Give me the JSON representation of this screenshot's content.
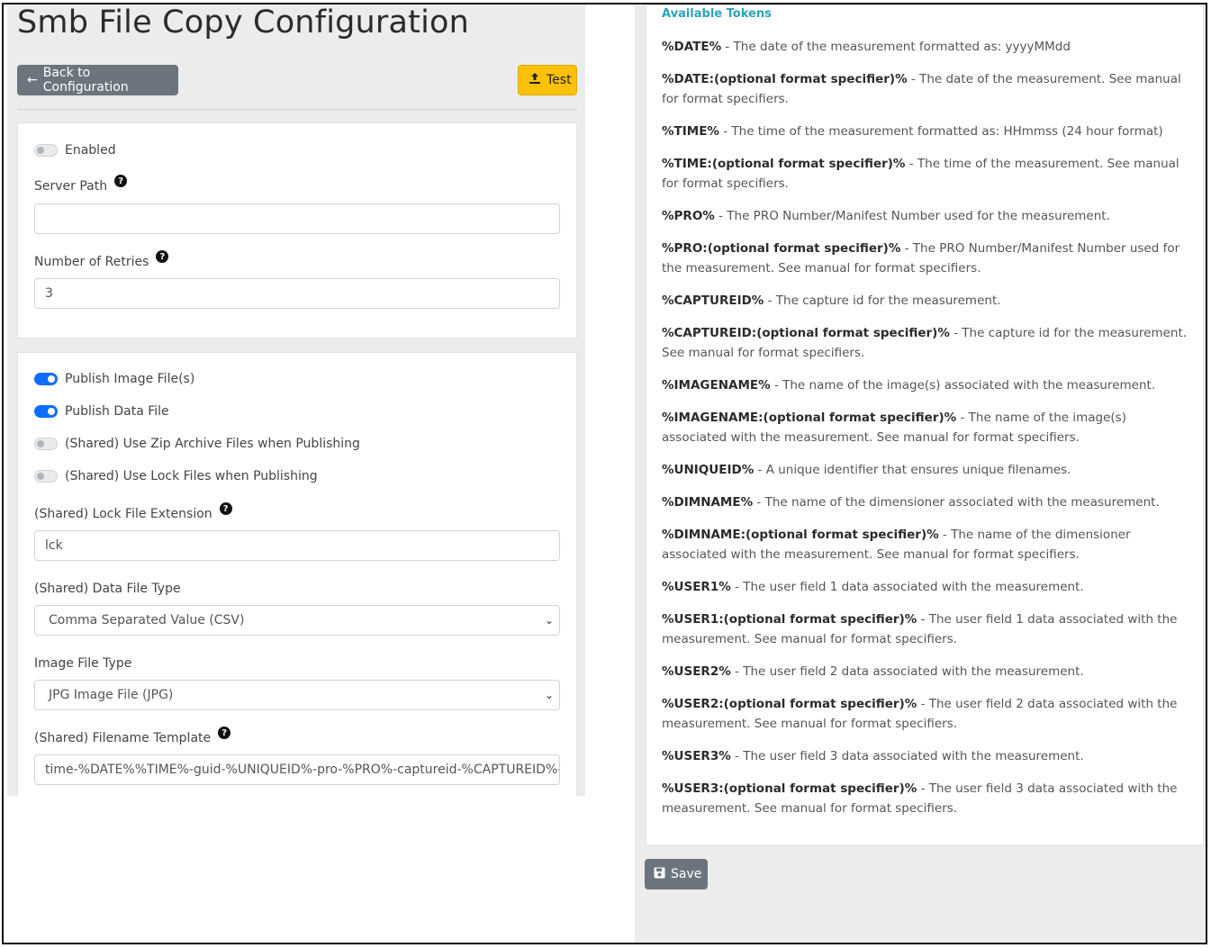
{
  "page": {
    "title": "Smb File Copy Configuration"
  },
  "toolbar": {
    "back_label": "Back to Configuration",
    "test_label": "Test",
    "save_label": "Save"
  },
  "general": {
    "enabled_label": "Enabled",
    "server_path_label": "Server Path",
    "server_path_value": "",
    "retries_label": "Number of Retries",
    "retries_value": "3"
  },
  "publish": {
    "toggles": [
      {
        "label": "Publish Image File(s)",
        "on": true
      },
      {
        "label": "Publish Data File",
        "on": true
      },
      {
        "label": "(Shared) Use Zip Archive Files when Publishing",
        "on": false
      },
      {
        "label": "(Shared) Use Lock Files when Publishing",
        "on": false
      }
    ],
    "lock_ext_label": "(Shared) Lock File Extension",
    "lock_ext_value": "lck",
    "data_type_label": "(Shared) Data File Type",
    "data_type_value": "Comma Separated Value (CSV)",
    "image_type_label": "Image File Type",
    "image_type_value": "JPG Image File (JPG)",
    "template_label": "(Shared) Filename Template",
    "template_value": "time-%DATE%%TIME%-guid-%UNIQUEID%-pro-%PRO%-captureid-%CAPTUREID%-%IMAGENAME%"
  },
  "tokens": {
    "heading": "Available Tokens",
    "items": [
      {
        "token": "%DATE%",
        "desc": " - The date of the measurement formatted as: yyyyMMdd"
      },
      {
        "token": "%DATE:(optional format specifier)%",
        "desc": " - The date of the measurement. See manual for format specifiers."
      },
      {
        "token": "%TIME%",
        "desc": " - The time of the measurement formatted as: HHmmss (24 hour format)"
      },
      {
        "token": "%TIME:(optional format specifier)%",
        "desc": " - The time of the measurement. See manual for format specifiers."
      },
      {
        "token": "%PRO%",
        "desc": " - The PRO Number/Manifest Number used for the measurement."
      },
      {
        "token": "%PRO:(optional format specifier)%",
        "desc": " - The PRO Number/Manifest Number used for the measurement. See manual for format specifiers."
      },
      {
        "token": "%CAPTUREID%",
        "desc": " - The capture id for the measurement."
      },
      {
        "token": "%CAPTUREID:(optional format specifier)%",
        "desc": " - The capture id for the measurement. See manual for format specifiers."
      },
      {
        "token": "%IMAGENAME%",
        "desc": " - The name of the image(s) associated with the measurement."
      },
      {
        "token": "%IMAGENAME:(optional format specifier)%",
        "desc": " - The name of the image(s) associated with the measurement. See manual for format specifiers."
      },
      {
        "token": "%UNIQUEID%",
        "desc": " - A unique identifier that ensures unique filenames."
      },
      {
        "token": "%DIMNAME%",
        "desc": " - The name of the dimensioner associated with the measurement."
      },
      {
        "token": "%DIMNAME:(optional format specifier)%",
        "desc": " - The name of the dimensioner associated with the measurement. See manual for format specifiers."
      },
      {
        "token": "%USER1%",
        "desc": " - The user field 1 data associated with the measurement."
      },
      {
        "token": "%USER1:(optional format specifier)%",
        "desc": " - The user field 1 data associated with the measurement. See manual for format specifiers."
      },
      {
        "token": "%USER2%",
        "desc": " - The user field 2 data associated with the measurement."
      },
      {
        "token": "%USER2:(optional format specifier)%",
        "desc": " - The user field 2 data associated with the measurement. See manual for format specifiers."
      },
      {
        "token": "%USER3%",
        "desc": " - The user field 3 data associated with the measurement."
      },
      {
        "token": "%USER3:(optional format specifier)%",
        "desc": " - The user field 3 data associated with the measurement. See manual for format specifiers."
      }
    ]
  }
}
